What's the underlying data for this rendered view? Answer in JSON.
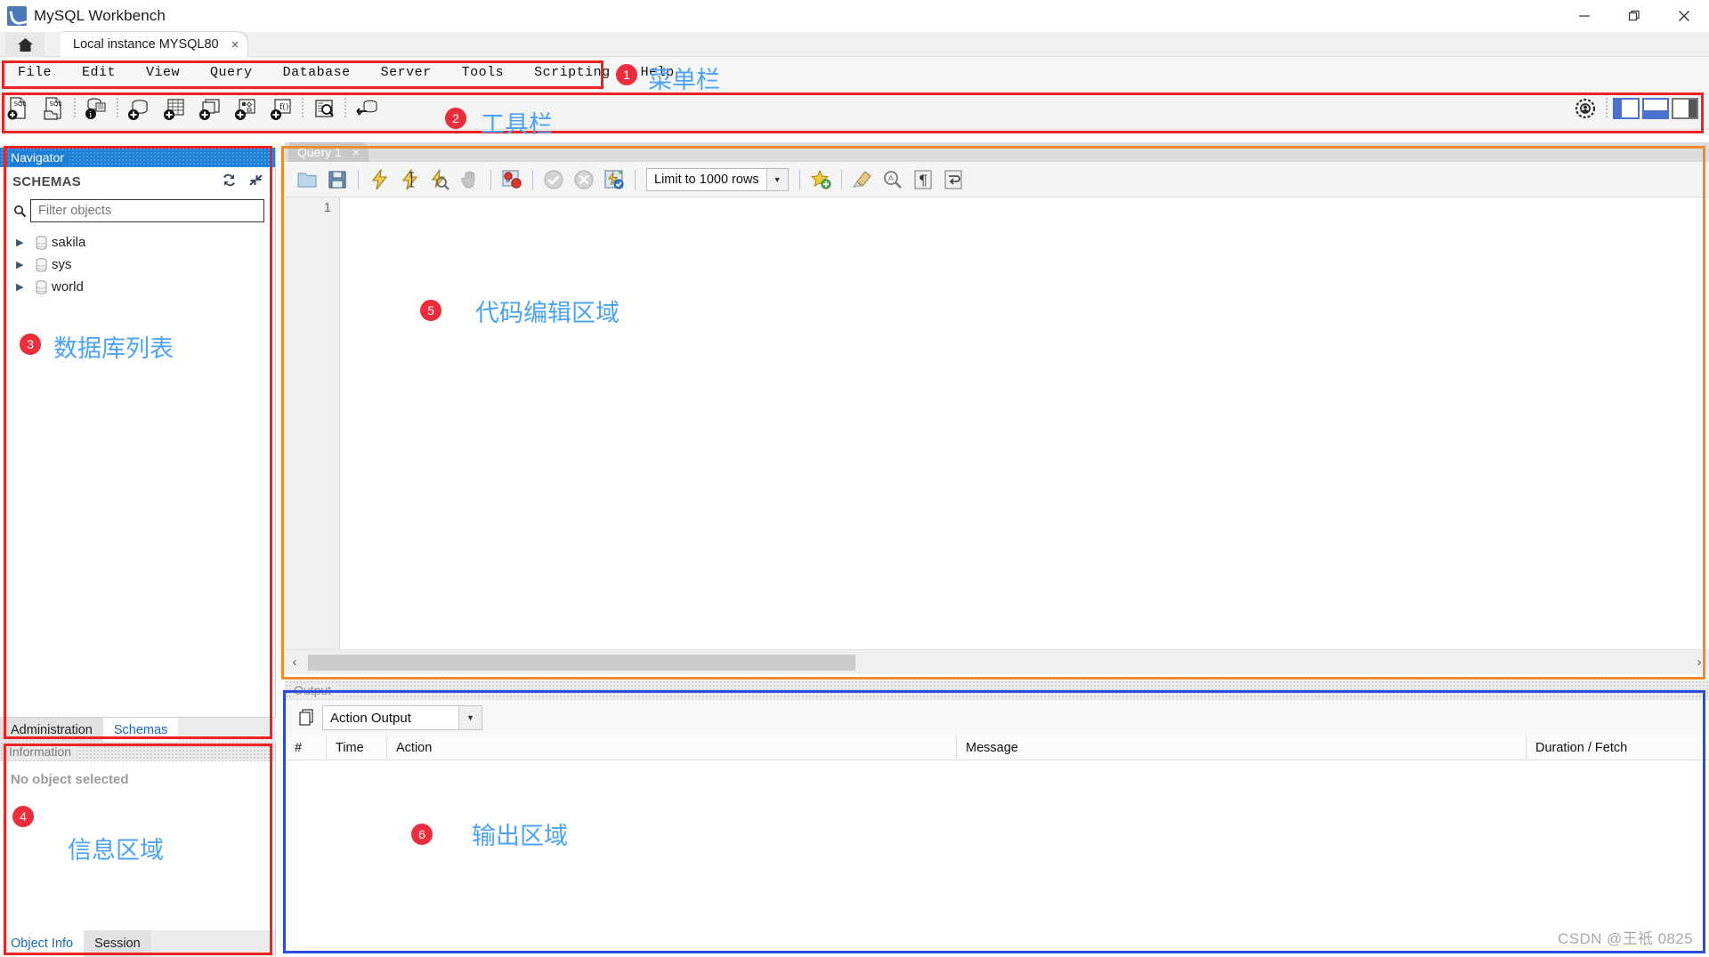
{
  "window": {
    "title": "MySQL Workbench",
    "logo_icon": "mysql-dolphin-icon",
    "minimize_icon": "minimize-icon",
    "restore_icon": "restore-icon",
    "close_icon": "close-icon"
  },
  "tabstrip": {
    "home_icon": "home-icon",
    "connection_tab": "Local instance MYSQL80",
    "close_glyph": "×"
  },
  "menubar": {
    "items": [
      {
        "label": "File"
      },
      {
        "label": "Edit"
      },
      {
        "label": "View"
      },
      {
        "label": "Query"
      },
      {
        "label": "Database"
      },
      {
        "label": "Server"
      },
      {
        "label": "Tools"
      },
      {
        "label": "Scripting"
      },
      {
        "label": "Help"
      }
    ]
  },
  "toolbar": {
    "icons": [
      "new-sql-tab-icon",
      "open-sql-script-icon",
      "sep",
      "connection-info-icon",
      "sep",
      "create-schema-icon",
      "create-table-icon",
      "create-view-icon",
      "create-procedure-icon",
      "create-function-icon",
      "sep",
      "search-data-icon",
      "sep",
      "reconnect-server-icon"
    ],
    "right_icons": [
      "target-mode-icon",
      "sidebar-layout-icon",
      "output-layout-icon",
      "secondary-sidebar-layout-icon"
    ]
  },
  "navigator": {
    "header": "Navigator",
    "section_title": "SCHEMAS",
    "refresh_icon": "refresh-icon",
    "collapse_icon": "collapse-all-icon",
    "search_icon": "search-icon",
    "filter_placeholder": "Filter objects",
    "filter_value": "",
    "schemas": [
      {
        "name": "sakila",
        "expander": "▶",
        "icon": "database-icon"
      },
      {
        "name": "sys",
        "expander": "▶",
        "icon": "database-icon"
      },
      {
        "name": "world",
        "expander": "▶",
        "icon": "database-icon"
      }
    ],
    "tabs": [
      {
        "label": "Administration",
        "active": false
      },
      {
        "label": "Schemas",
        "active": true
      }
    ]
  },
  "information": {
    "header": "Information",
    "empty_text": "No object selected",
    "tabs": [
      {
        "label": "Object Info",
        "active": true
      },
      {
        "label": "Session",
        "active": false
      }
    ]
  },
  "query_editor": {
    "tab_label": "Query 1",
    "tab_close": "×",
    "toolbar_icons": [
      "open-script-icon",
      "save-script-icon",
      "sep",
      "execute-statement-icon",
      "execute-current-statement-icon",
      "explain-query-icon",
      "stop-execution-icon",
      "sep",
      "toggle-stop-on-error-icon",
      "sep",
      "commit-transaction-icon",
      "rollback-transaction-icon",
      "toggle-autocommit-icon",
      "sep"
    ],
    "limit_label": "Limit to 1000 rows",
    "limit_arrow": "▼",
    "trailing_icons": [
      "beautify-sql-icon",
      "sep",
      "clear-context-icon",
      "find-icon",
      "invisible-chars-icon",
      "wrap-lines-icon"
    ],
    "line_numbers": [
      "1"
    ],
    "content": "",
    "scroll_left_arrow": "‹",
    "scroll_right_arrow": "›"
  },
  "output": {
    "header": "Output",
    "copy_icon": "copy-rows-icon",
    "selected_view": "Action Output",
    "dropdown_arrow": "▼",
    "columns": [
      "#",
      "Time",
      "Action",
      "Message",
      "Duration / Fetch"
    ],
    "rows": []
  },
  "watermark": "CSDN @王祗 0825",
  "annotations": [
    {
      "number": "1",
      "label": "菜单栏",
      "color": "#ee2222"
    },
    {
      "number": "2",
      "label": "工具栏",
      "color": "#ee2222"
    },
    {
      "number": "3",
      "label": "数据库列表",
      "color": "#ee2222"
    },
    {
      "number": "4",
      "label": "信息区域",
      "color": "#ee2222"
    },
    {
      "number": "5",
      "label": "代码编辑区域",
      "color": "#f08a2a"
    },
    {
      "number": "6",
      "label": "输出区域",
      "color": "#2a4fe0"
    }
  ]
}
